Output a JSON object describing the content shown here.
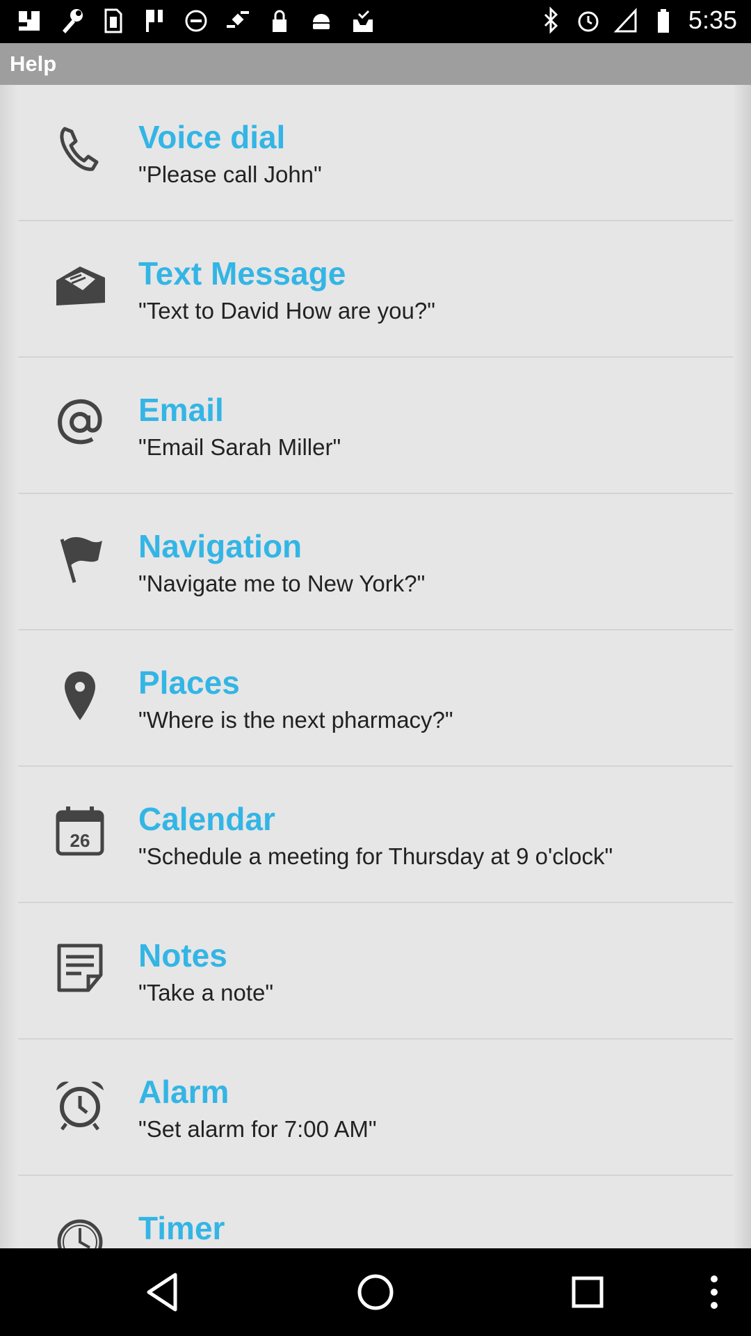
{
  "status_bar": {
    "time": "5:35",
    "left_icons": [
      "image-icon",
      "wrench-icon",
      "sim-card-icon",
      "flag-icon",
      "do-not-disturb-icon",
      "fake-location-icon",
      "lock-icon",
      "android-icon",
      "download-complete-icon"
    ],
    "right_icons": [
      "bluetooth-icon",
      "alarm-clock-icon",
      "signal-off-icon",
      "battery-icon"
    ]
  },
  "header": {
    "title": "Help"
  },
  "help_items": [
    {
      "icon": "phone-icon",
      "title": "Voice dial",
      "example": "\"Please call John\""
    },
    {
      "icon": "envelope-icon",
      "title": "Text Message",
      "example": "\"Text to David How are you?\""
    },
    {
      "icon": "at-sign-icon",
      "title": "Email",
      "example": "\"Email Sarah Miller\""
    },
    {
      "icon": "flag-icon",
      "title": "Navigation",
      "example": "\"Navigate me to New York?\""
    },
    {
      "icon": "map-pin-icon",
      "title": "Places",
      "example": "\"Where is the next pharmacy?\""
    },
    {
      "icon": "calendar-icon",
      "title": "Calendar",
      "example": "\"Schedule a meeting for Thursday at 9 o'clock\"",
      "icon_text": "26"
    },
    {
      "icon": "notes-icon",
      "title": "Notes",
      "example": "\"Take a note\""
    },
    {
      "icon": "alarm-clock-icon",
      "title": "Alarm",
      "example": "\"Set alarm for 7:00 AM\""
    },
    {
      "icon": "timer-icon",
      "title": "Timer",
      "example": ""
    }
  ],
  "colors": {
    "accent": "#33b5e5",
    "title_bar": "#9e9e9e",
    "background": "#e6e6e6"
  },
  "nav_bar": [
    "back-icon",
    "home-icon",
    "recents-icon",
    "more-options-icon"
  ]
}
